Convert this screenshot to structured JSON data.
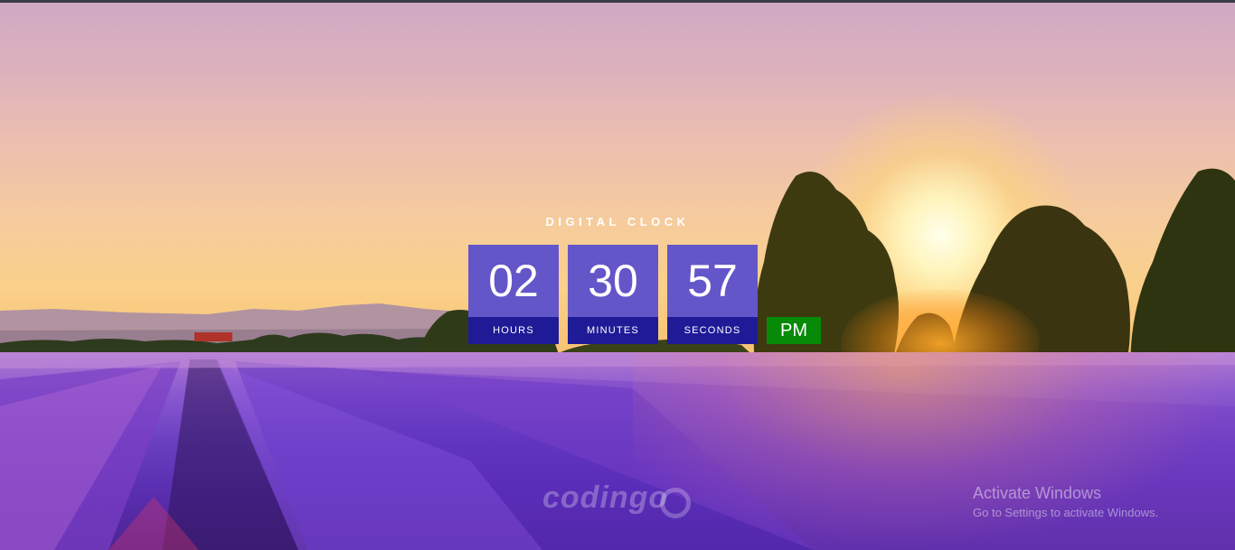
{
  "clock": {
    "title": "DIGITAL CLOCK",
    "hours": "02",
    "minutes": "30",
    "seconds": "57",
    "hours_label": "HOURS",
    "minutes_label": "MINUTES",
    "seconds_label": "SECONDS",
    "period": "PM"
  },
  "watermark": {
    "logo_text": "codingo"
  },
  "activate_windows": {
    "title": "Activate Windows",
    "subtitle": "Go to Settings to activate Windows."
  },
  "colors": {
    "value_tile": "#6356c9",
    "label_tile": "#1f1b97",
    "period_badge": "#078a07",
    "title_text": "#ffffff"
  }
}
